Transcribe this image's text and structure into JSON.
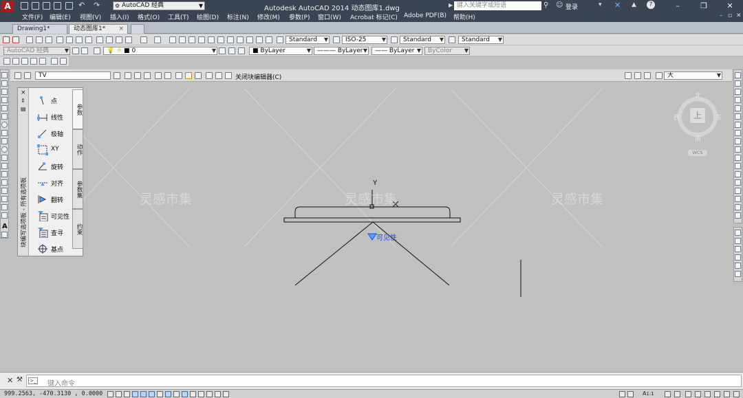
{
  "app": {
    "title": "Autodesk AutoCAD 2014    动态图库1.dwg",
    "logo_letter": "A",
    "workspace": "AutoCAD 经典",
    "search_placeholder": "键入关键字或短语",
    "login_label": "登录",
    "help_label": "?"
  },
  "menu": {
    "items": [
      "文件(F)",
      "编辑(E)",
      "视图(V)",
      "插入(I)",
      "格式(O)",
      "工具(T)",
      "绘图(D)",
      "标注(N)",
      "修改(M)",
      "参数(P)",
      "窗口(W)",
      "Acrobat 标记(C)",
      "Adobe PDF(B)",
      "帮助(H)"
    ]
  },
  "tabs": [
    "Drawing1*",
    "动态图库1*"
  ],
  "styles_toolbar": {
    "text_style": "Standard",
    "dim_style": "ISO-25",
    "table_style": "Standard",
    "mleader_style": "Standard"
  },
  "layers_toolbar": {
    "workspace": "AutoCAD 经典",
    "layer": "0"
  },
  "properties_toolbar": {
    "color": "ByLayer",
    "linetype": "ByLayer",
    "lineweight": "ByLayer",
    "plotstyle": "ByColor"
  },
  "block_editor": {
    "block_name": "TV",
    "close_label": "关闭块编辑器(C)",
    "scale_value": "大"
  },
  "palette": {
    "title": "块编写选项板 - 所有选项板",
    "tabs": [
      "参数",
      "动作",
      "参数集",
      "约束"
    ],
    "items": [
      "点",
      "线性",
      "极轴",
      "XY",
      "旋转",
      "对齐",
      "翻转",
      "可见性",
      "查寻",
      "基点"
    ]
  },
  "canvas": {
    "watermarks": [
      "灵感市集",
      "灵感市集",
      "灵感市集"
    ],
    "y_axis_label": "Y",
    "visibility_label": "可见性"
  },
  "viewcube": {
    "north": "北",
    "south": "南",
    "east": "东",
    "west": "西",
    "face": "上",
    "wcs": "WCS"
  },
  "command": {
    "placeholder": "键入命令"
  },
  "status": {
    "coords": "999.2563,  -470.3130 , 0.0000",
    "annotation_scale": "1:1"
  },
  "colors": {
    "titlebar": "#3b4452",
    "canvas": "#c0c0c0",
    "accent_blue": "#1f4fd8"
  }
}
